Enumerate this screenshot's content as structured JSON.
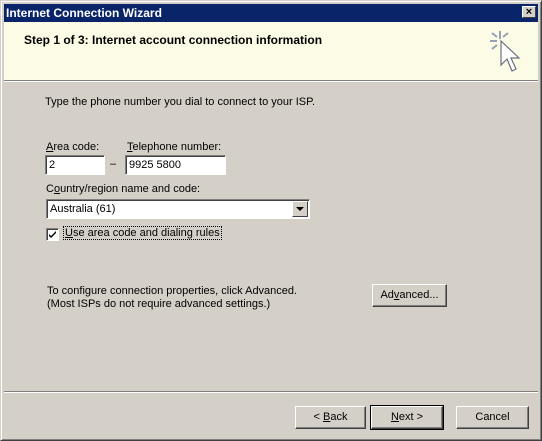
{
  "window": {
    "title": "Internet Connection Wizard",
    "close_glyph": "×"
  },
  "header": {
    "title": "Step 1 of 3: Internet account connection information",
    "icon": "wizard-cursor-icon"
  },
  "instructions": "Type the phone number you dial to connect to your ISP.",
  "area_code": {
    "label_mnemonic": "A",
    "label_rest": "rea code:",
    "value": "2"
  },
  "dash": "–",
  "telephone": {
    "label_mnemonic": "T",
    "label_rest": "elephone number:",
    "value": "9925 5800"
  },
  "country": {
    "label_pre": "C",
    "label_mnemonic": "o",
    "label_rest": "untry/region name and code:",
    "selected": "Australia (61)"
  },
  "use_rules": {
    "checked": true,
    "label_mnemonic": "U",
    "label_rest": "se area code and dialing rules"
  },
  "advanced_text": {
    "line1": "To configure connection properties, click Advanced.",
    "line2": "(Most ISPs do not require advanced settings.)"
  },
  "advanced_button": {
    "pre": "Ad",
    "mnemonic": "v",
    "rest": "anced..."
  },
  "footer": {
    "back": {
      "prefix": "< ",
      "mnemonic": "B",
      "rest": "ack"
    },
    "next": {
      "mnemonic": "N",
      "rest": "ext >"
    },
    "cancel": "Cancel"
  }
}
